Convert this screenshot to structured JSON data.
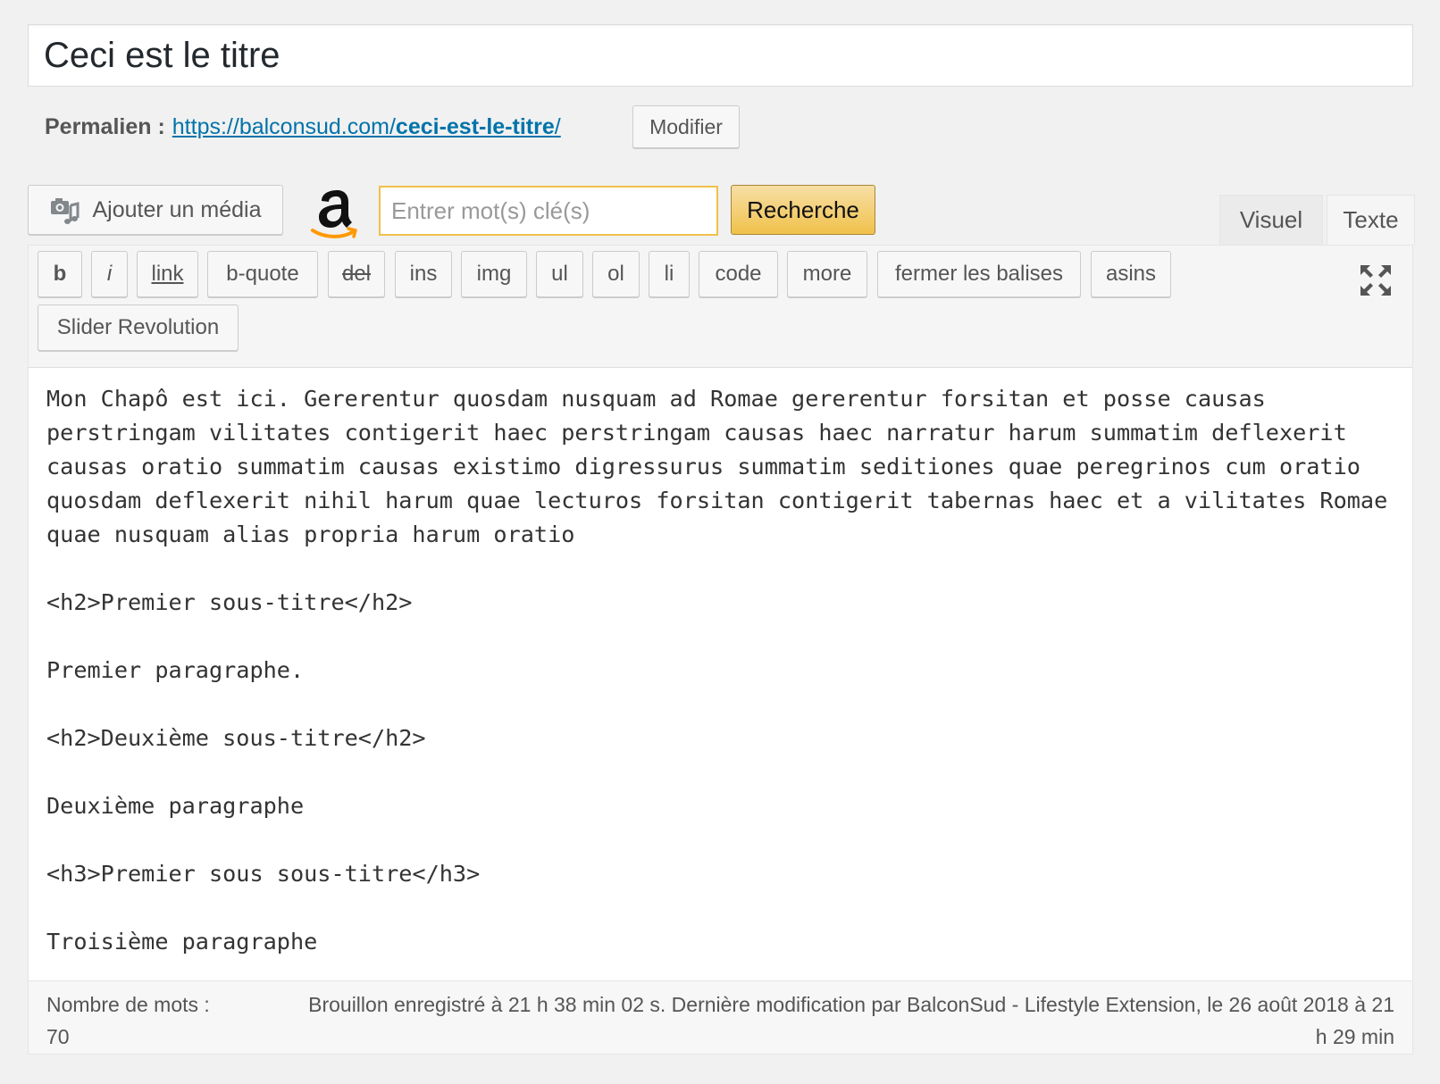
{
  "title": {
    "value": "Ceci est le titre"
  },
  "permalink": {
    "label": "Permalien :",
    "url_base": "https://balconsud.com/",
    "url_slug": "ceci-est-le-titre",
    "url_end": "/",
    "edit_label": "Modifier"
  },
  "media": {
    "add_media_label": "Ajouter un média",
    "media_icon": "camera-music-icon"
  },
  "amazon": {
    "logo": "amazon-logo-icon",
    "keyword_placeholder": "Entrer mot(s) clé(s)",
    "search_label": "Recherche",
    "accent": "#f0c14b"
  },
  "tabs": {
    "visual": "Visuel",
    "text": "Texte"
  },
  "quicktags": [
    "b",
    "i",
    "link",
    "b-quote",
    "del",
    "ins",
    "img",
    "ul",
    "ol",
    "li",
    "code",
    "more",
    "fermer les balises",
    "asins",
    "Slider Revolution"
  ],
  "editor": {
    "content": "Mon Chapô est ici. Gererentur quosdam nusquam ad Romae gererentur forsitan et posse causas perstringam vilitates contigerit haec perstringam causas haec narratur harum summatim deflexerit causas oratio summatim causas existimo digressurus summatim seditiones quae peregrinos cum oratio quosdam deflexerit nihil harum quae lecturos forsitan contigerit tabernas haec et a vilitates Romae quae nusquam alias propria harum oratio\n\n<h2>Premier sous-titre</h2>\n\nPremier paragraphe.\n\n<h2>Deuxième sous-titre</h2>\n\nDeuxième paragraphe\n\n<h3>Premier sous sous-titre</h3>\n\nTroisième paragraphe"
  },
  "footer": {
    "word_count_label": "Nombre de mots :",
    "word_count": "70",
    "autosave": "Brouillon enregistré à 21 h 38 min 02 s. Dernière modification par BalconSud - Lifestyle Extension, le 26 août 2018 à 21 h 29 min"
  },
  "colors": {
    "link": "#0073aa",
    "page_bg": "#f1f1f1"
  }
}
